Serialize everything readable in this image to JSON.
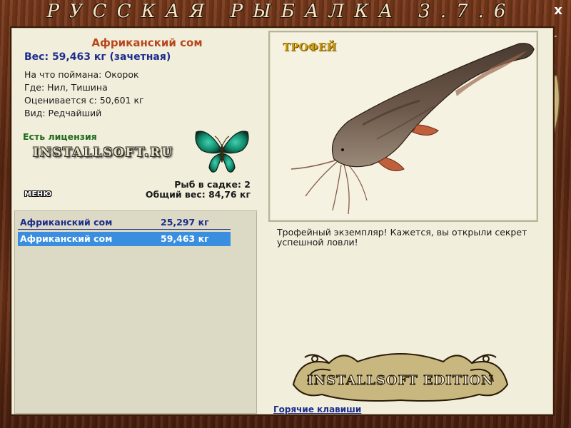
{
  "window": {
    "title": "РУССКАЯ РЫБАЛКА 3.7.6",
    "close_label": "x"
  },
  "catch": {
    "name": "Африканский сом",
    "weight_line": "Вес: 59,463 кг (зачетная)",
    "bait_line": "На что поймана: Окорок",
    "place_line": "Где: Нил, Тишина",
    "rated_line": "Оценивается с: 50,601 кг",
    "kind_line": "Вид: Редчайший"
  },
  "license": {
    "text": "Есть лицензия",
    "logo_text": "INSTALLSOFT.RU"
  },
  "cage": {
    "count_line": "Рыб в садке: 2",
    "total_line": "Общий вес: 84,76 кг"
  },
  "menu": {
    "label": "МЕНЮ"
  },
  "catch_list": [
    {
      "name": "Африканский сом",
      "weight": "25,297 кг"
    },
    {
      "name": "Африканский сом",
      "weight": "59,463 кг"
    }
  ],
  "trophy": {
    "label": "ТРОФЕЙ",
    "message": "Трофейный экземпляр! Кажется, вы открыли секрет успешной ловли!"
  },
  "edition_logo_text": "INSTALLSOFT EDITION",
  "hotkeys_label": "Горячие клавиши",
  "colors": {
    "frame_wood": "#5b2812",
    "parchment": "#f2eedc",
    "fish_name": "#b7471b",
    "link_blue": "#1d2d8c",
    "license_green": "#1f6b1c",
    "selected_row": "#3a8ee0",
    "trophy_gold": "#c89a10"
  },
  "icons": [
    "butterfly-icon",
    "catfish-image",
    "lure-icon",
    "close-icon"
  ]
}
